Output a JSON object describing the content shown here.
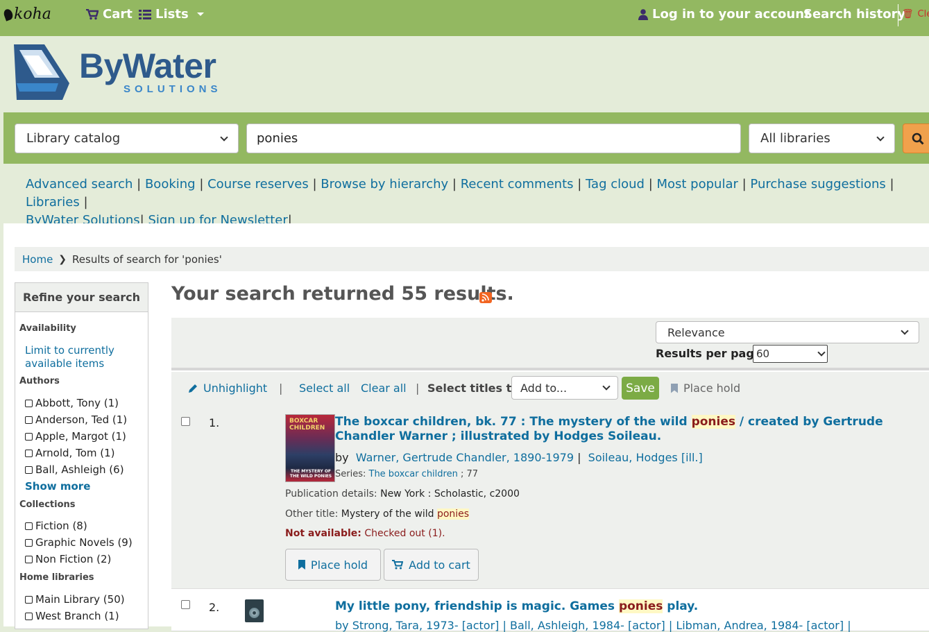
{
  "navbar": {
    "logo": "koha",
    "cart": "Cart",
    "lists": "Lists",
    "login": "Log in to your account",
    "search_history": "Search history",
    "clear": "Cle"
  },
  "branding": {
    "name": "ByWater",
    "sub": "SOLUTIONS"
  },
  "search": {
    "catalog_select": "Library catalog",
    "query": "ponies",
    "library_select": "All libraries"
  },
  "more_searches": {
    "links": [
      "Advanced search",
      "Booking",
      "Course reserves",
      "Browse by hierarchy",
      "Recent comments",
      "Tag cloud",
      "Most popular",
      "Purchase suggestions",
      "Libraries",
      "ByWater Solutions",
      "Sign up for Newsletter"
    ]
  },
  "breadcrumb": {
    "home": "Home",
    "current": "Results of search for 'ponies'"
  },
  "facets": {
    "heading": "Refine your search",
    "availability": {
      "title": "Availability",
      "link": "Limit to currently available items"
    },
    "authors": {
      "title": "Authors",
      "items": [
        "Abbott, Tony (1)",
        "Anderson, Ted (1)",
        "Apple, Margot (1)",
        "Arnold, Tom (1)",
        "Ball, Ashleigh (6)"
      ],
      "show_more": "Show more"
    },
    "collections": {
      "title": "Collections",
      "items": [
        "Fiction (8)",
        "Graphic Novels (9)",
        "Non Fiction (2)"
      ]
    },
    "home_libraries": {
      "title": "Home libraries",
      "items": [
        "Main Library (50)",
        "West Branch (1)"
      ]
    }
  },
  "results": {
    "heading": "Your search returned 55 results.",
    "sort": "Relevance",
    "per_page_label": "Results per page:",
    "per_page": "60",
    "toolbar": {
      "unhighlight": "Unhighlight",
      "select_all": "Select all",
      "clear_all": "Clear all",
      "select_titles": "Select titles to:",
      "add_to": "Add to...",
      "save": "Save",
      "place_hold": "Place hold"
    },
    "items": [
      {
        "num": "1.",
        "title_pre": "The boxcar children, bk. 77 : The mystery of the wild ",
        "title_hl": "ponies",
        "title_post": " / created by Gertrude Chandler Warner ; illustrated by Hodges Soileau.",
        "by": "by",
        "author1": "Warner, Gertrude Chandler, 1890-1979",
        "author2": "Soileau, Hodges [ill.]",
        "series_label": "Series:",
        "series": "The boxcar children",
        "series_num": "; 77",
        "pub_label": "Publication details:",
        "pub": "New York : Scholastic, c2000",
        "other_label": "Other title:",
        "other": "Mystery of the wild ",
        "other_hl": "ponies",
        "avail_label": "Not available:",
        "avail": "Checked out (1).",
        "cover_title": "BOXCAR CHILDREN",
        "cover_sub": "THE MYSTERY OF THE WILD PONIES",
        "place_hold": "Place hold",
        "add_cart": "Add to cart"
      },
      {
        "num": "2.",
        "title_pre": "My little pony, friendship is magic. Games ",
        "title_hl": "ponies",
        "title_post": " play.",
        "authors_line": "by  Strong, Tara, 1973- [actor] |  Ball, Ashleigh, 1984- [actor] |  Libman, Andrea, 1984- [actor] |"
      }
    ]
  },
  "colors": {
    "nav_green": "#93b861",
    "link": "#0f6e9e",
    "highlight": "#fff8c4",
    "search_btn": "#f0a14c"
  }
}
